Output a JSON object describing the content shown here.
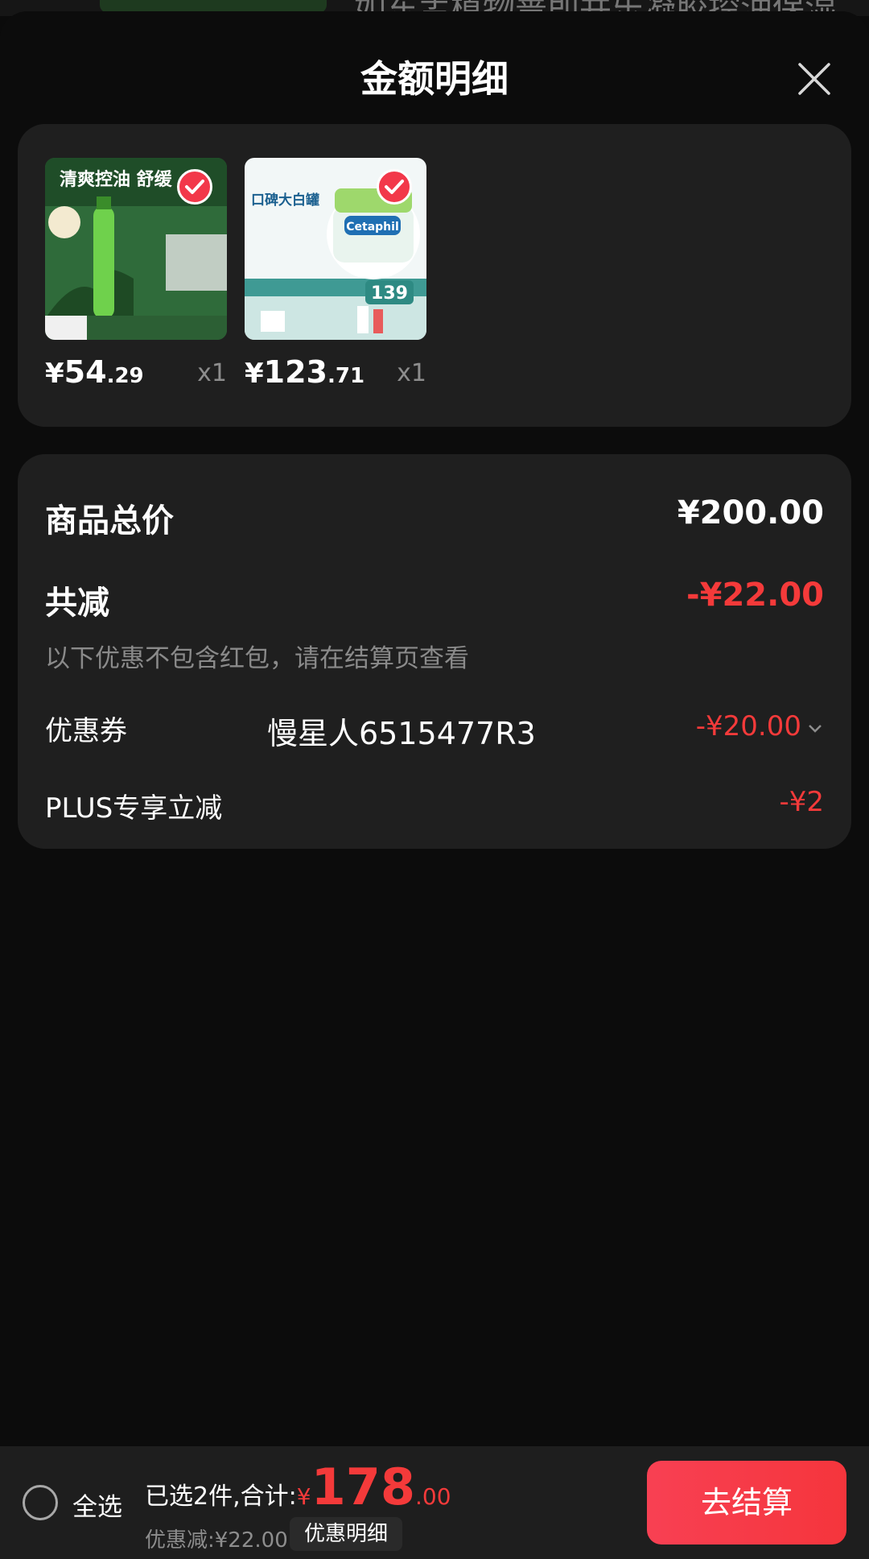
{
  "peek": {
    "text": "如东孟植物蔷即并乐凝胶控油保湿"
  },
  "sheet": {
    "title": "金额明细"
  },
  "products": [
    {
      "image_text": "清爽控油 舒缓",
      "yen": "¥",
      "int": "54",
      "dec": ".29",
      "qty": "x1"
    },
    {
      "image_text": "口碑大白罐",
      "brand": "Cetaphil",
      "promo_price": "139",
      "yen": "¥",
      "int": "123",
      "dec": ".71",
      "qty": "x1"
    }
  ],
  "summary": {
    "total_label": "商品总价",
    "total_value": "¥200.00",
    "reduce_label": "共减",
    "reduce_value": "-¥22.00",
    "note": "以下优惠不包含红包，请在结算页查看",
    "coupon_label": "优惠券",
    "coupon_value": "-¥20.00",
    "plus_label": "PLUS专享立减",
    "plus_value": "-¥2"
  },
  "watermark": "慢星人6515477R3",
  "bottom": {
    "select_all": "全选",
    "selected_label": "已选2件,合计:",
    "total_yen": "¥",
    "total_int": "178",
    "total_dec": ".00",
    "discount_text": "优惠减:¥22.00",
    "detail_button": "优惠明细",
    "checkout_button": "去结算"
  },
  "colors": {
    "accent_red": "#f43a3a",
    "card_bg": "#1f1f1f",
    "page_bg": "#0c0c0c"
  }
}
